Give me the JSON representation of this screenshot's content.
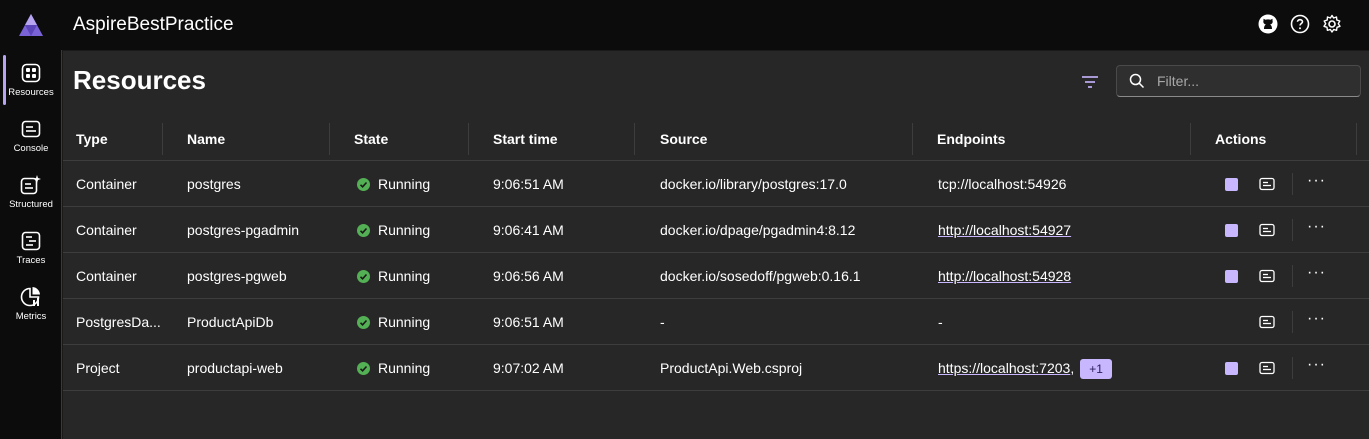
{
  "app": {
    "title": "AspireBestPractice"
  },
  "header": {
    "icons": [
      "github-icon",
      "help-icon",
      "settings-icon"
    ]
  },
  "nav": {
    "items": [
      {
        "label": "Resources",
        "icon": "resources-icon",
        "active": true
      },
      {
        "label": "Console",
        "icon": "console-icon",
        "active": false
      },
      {
        "label": "Structured",
        "icon": "structured-icon",
        "active": false
      },
      {
        "label": "Traces",
        "icon": "traces-icon",
        "active": false
      },
      {
        "label": "Metrics",
        "icon": "metrics-icon",
        "active": false
      }
    ]
  },
  "page": {
    "title": "Resources",
    "search_placeholder": "Filter..."
  },
  "table": {
    "columns": [
      "Type",
      "Name",
      "State",
      "Start time",
      "Source",
      "Endpoints",
      "Actions"
    ],
    "rows": [
      {
        "type": "Container",
        "name": "postgres",
        "state": "Running",
        "start": "9:06:51 AM",
        "source": "docker.io/library/postgres:17.0",
        "endpoint": "tcp://localhost:54926",
        "endpoint_link": false,
        "extra": "",
        "has_stop": true
      },
      {
        "type": "Container",
        "name": "postgres-pgadmin",
        "state": "Running",
        "start": "9:06:41 AM",
        "source": "docker.io/dpage/pgadmin4:8.12",
        "endpoint": "http://localhost:54927",
        "endpoint_link": true,
        "extra": "",
        "has_stop": true
      },
      {
        "type": "Container",
        "name": "postgres-pgweb",
        "state": "Running",
        "start": "9:06:56 AM",
        "source": "docker.io/sosedoff/pgweb:0.16.1",
        "endpoint": "http://localhost:54928",
        "endpoint_link": true,
        "extra": "",
        "has_stop": true
      },
      {
        "type": "PostgresDa...",
        "name": "ProductApiDb",
        "state": "Running",
        "start": "9:06:51 AM",
        "source": "-",
        "endpoint": "-",
        "endpoint_link": false,
        "extra": "",
        "has_stop": false
      },
      {
        "type": "Project",
        "name": "productapi-web",
        "state": "Running",
        "start": "9:07:02 AM",
        "source": "ProductApi.Web.csproj",
        "endpoint": "https://localhost:7203",
        "endpoint_link": true,
        "extra": "+1",
        "has_stop": true
      }
    ]
  },
  "colors": {
    "accent": "#c8b6ff",
    "running": "#54b054",
    "background": "#272727",
    "chrome": "#0c0c0c"
  }
}
